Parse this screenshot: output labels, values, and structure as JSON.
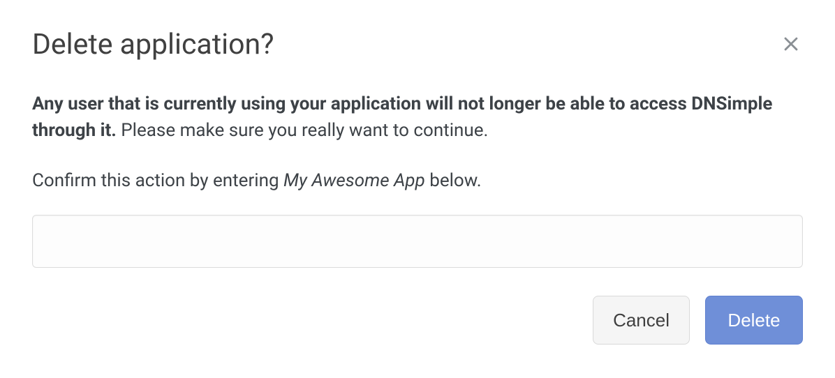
{
  "dialog": {
    "title": "Delete application?",
    "warning_bold": "Any user that is currently using your application will not longer be able to access DNSimple through it.",
    "warning_rest": " Please make sure you really want to continue.",
    "confirm_pre": "Confirm this action by entering ",
    "confirm_app_name": "My Awesome App",
    "confirm_post": " below.",
    "input_value": "",
    "input_placeholder": "",
    "cancel_label": "Cancel",
    "delete_label": "Delete",
    "close_icon": "close-icon"
  }
}
